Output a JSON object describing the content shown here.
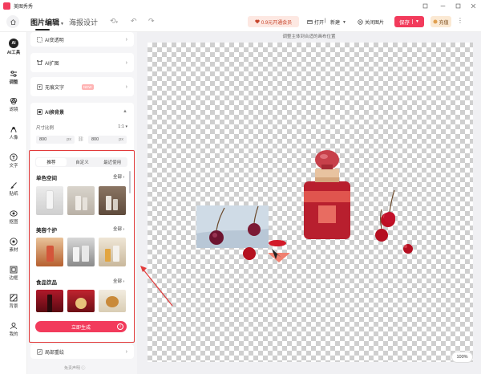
{
  "app": {
    "name": "美图秀秀"
  },
  "toolbar": {
    "tab_main": "图片编辑",
    "tab_secondary": "海报设计",
    "vip": "0.9元开通会员",
    "open": "打开",
    "new": "新建",
    "close_image": "关闭图片",
    "save": "保存",
    "recharge": "充值"
  },
  "rail": {
    "ai_tools": "AI工具",
    "items": [
      "调整",
      "滤镜",
      "人像",
      "文字",
      "贴纸",
      "抠图",
      "素材",
      "边框",
      "背景",
      "我的"
    ]
  },
  "panel": {
    "ai_transparent": "AI变透明",
    "ai_expand": "AI扩图",
    "remove_text": "无痕文字",
    "new_badge": "NEW",
    "ai_bg_title": "AI换背景",
    "size_ratio_label": "尺寸比例",
    "size_ratio_value": "1:1",
    "width_value": "800",
    "height_value": "800",
    "unit": "px",
    "subtabs": [
      "推荐",
      "自定义",
      "最近使用"
    ],
    "categories": [
      {
        "name": "单色空间",
        "all": "全部"
      },
      {
        "name": "美容个护",
        "all": "全部"
      },
      {
        "name": "食品饮品",
        "all": "全部"
      }
    ],
    "generate": "立即生成",
    "partial_redraw": "局部重绘",
    "disclaimer": "免责声明"
  },
  "canvas": {
    "hint": "调整主体到合适的画布位置",
    "zoom": "100%"
  },
  "colors": {
    "accent": "#f23b5c",
    "highlight": "#e23a3a"
  }
}
